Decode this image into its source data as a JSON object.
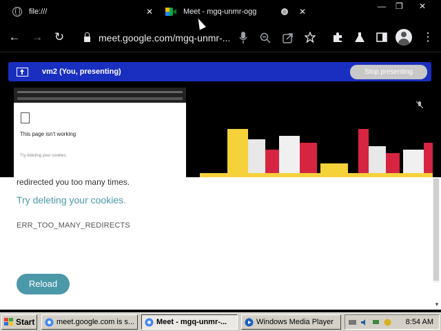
{
  "browser": {
    "tabs": [
      {
        "title": "file:///",
        "icon": "globe-icon",
        "active": false
      },
      {
        "title": "Meet - mgq-unmr-ogg",
        "icon": "meet-icon",
        "active": true
      }
    ],
    "url": "meet.google.com/mgq-unmr-..."
  },
  "meet": {
    "banner_text": "vm2 (You, presenting)",
    "stop_label": "Stop presenting",
    "thumb_title": "This page isn't working",
    "thumb_sub": "Try deleting your cookies.",
    "accent": "#1a2fc0"
  },
  "error_page": {
    "line1": "redirected you too many times.",
    "link": "Try deleting your cookies.",
    "code": "ERR_TOO_MANY_REDIRECTS",
    "reload_label": "Reload",
    "accent": "#4a98a8"
  },
  "taskbar": {
    "start_label": "Start",
    "tasks": [
      {
        "label": "meet.google.com is s...",
        "active": false
      },
      {
        "label": "Meet - mgq-unmr-...",
        "active": true
      },
      {
        "label": "Windows Media Player",
        "active": false
      }
    ],
    "clock": "8:54 AM"
  }
}
